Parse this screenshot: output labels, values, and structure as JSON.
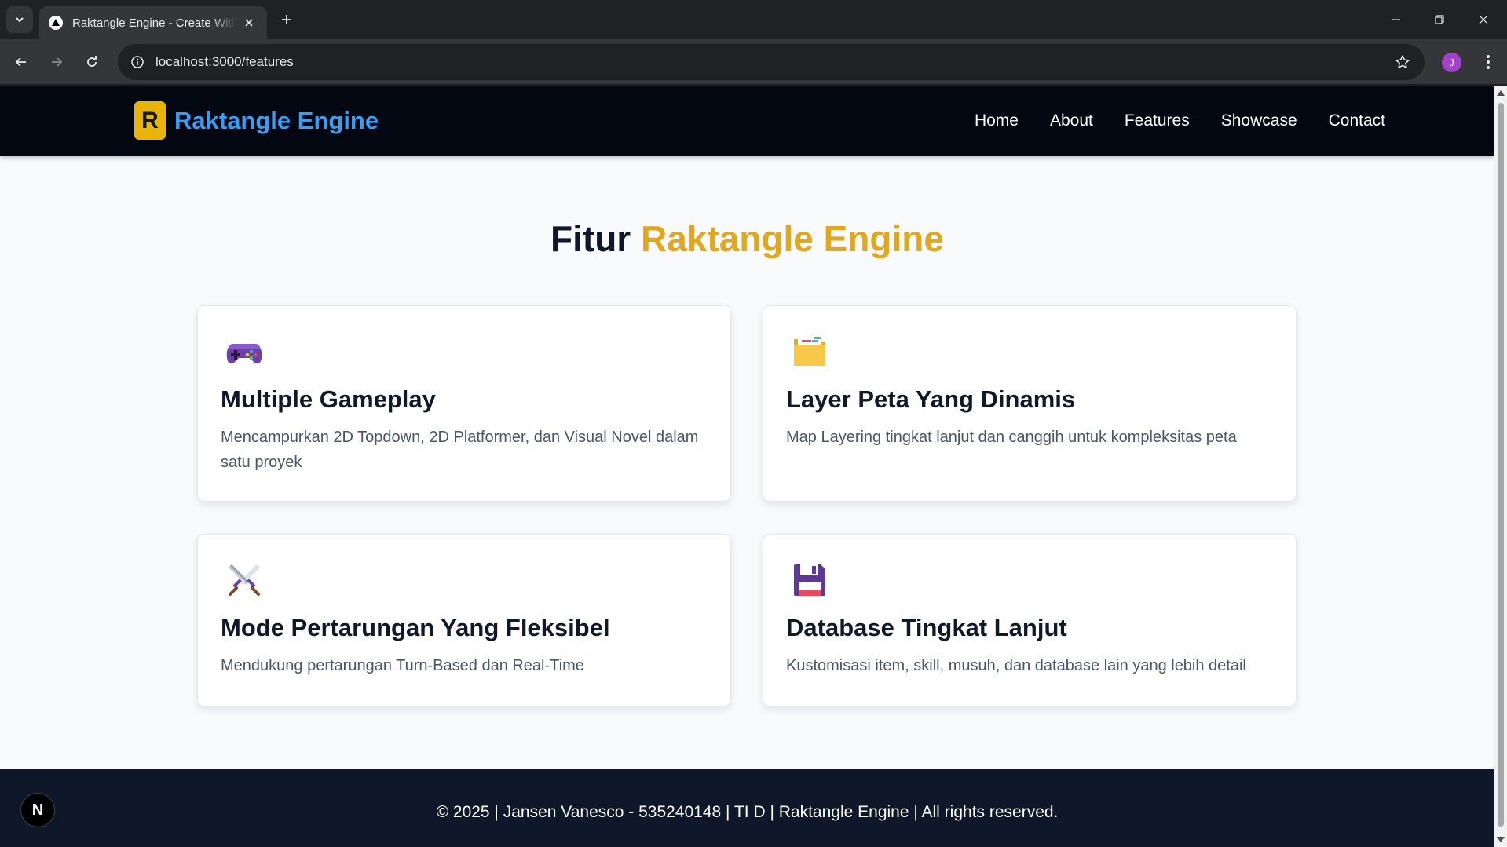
{
  "browser": {
    "tab_title": "Raktangle Engine - Create With Unity",
    "url": "localhost:3000/features",
    "profile_initial": "J"
  },
  "site": {
    "logo_letter": "R",
    "brand_name": "Raktangle Engine",
    "nav": [
      "Home",
      "About",
      "Features",
      "Showcase",
      "Contact"
    ]
  },
  "page": {
    "heading_main": "Fitur",
    "heading_accent": "Raktangle Engine"
  },
  "features": [
    {
      "icon": "gamepad-icon",
      "title": "Multiple Gameplay",
      "desc": "Mencampurkan 2D Topdown, 2D Platformer, dan Visual Novel dalam satu proyek"
    },
    {
      "icon": "folder-icon",
      "title": "Layer Peta Yang Dinamis",
      "desc": "Map Layering tingkat lanjut dan canggih untuk kompleksitas peta"
    },
    {
      "icon": "crossed-swords-icon",
      "title": "Mode Pertarungan Yang Fleksibel",
      "desc": "Mendukung pertarungan Turn-Based dan Real-Time"
    },
    {
      "icon": "floppy-disk-icon",
      "title": "Database Tingkat Lanjut",
      "desc": "Kustomisasi item, skill, musuh, dan database lain yang lebih detail"
    }
  ],
  "footer": {
    "text": "© 2025 | Jansen Vanesco - 535240148 | TI D | Raktangle Engine | All rights reserved."
  },
  "dev_badge": "N",
  "colors": {
    "navbar_bg": "#030712",
    "brand_blue": "#3b9cf0",
    "accent_gold": "#e0a820",
    "page_bg": "#f8fafc",
    "footer_bg": "#0f172a"
  }
}
